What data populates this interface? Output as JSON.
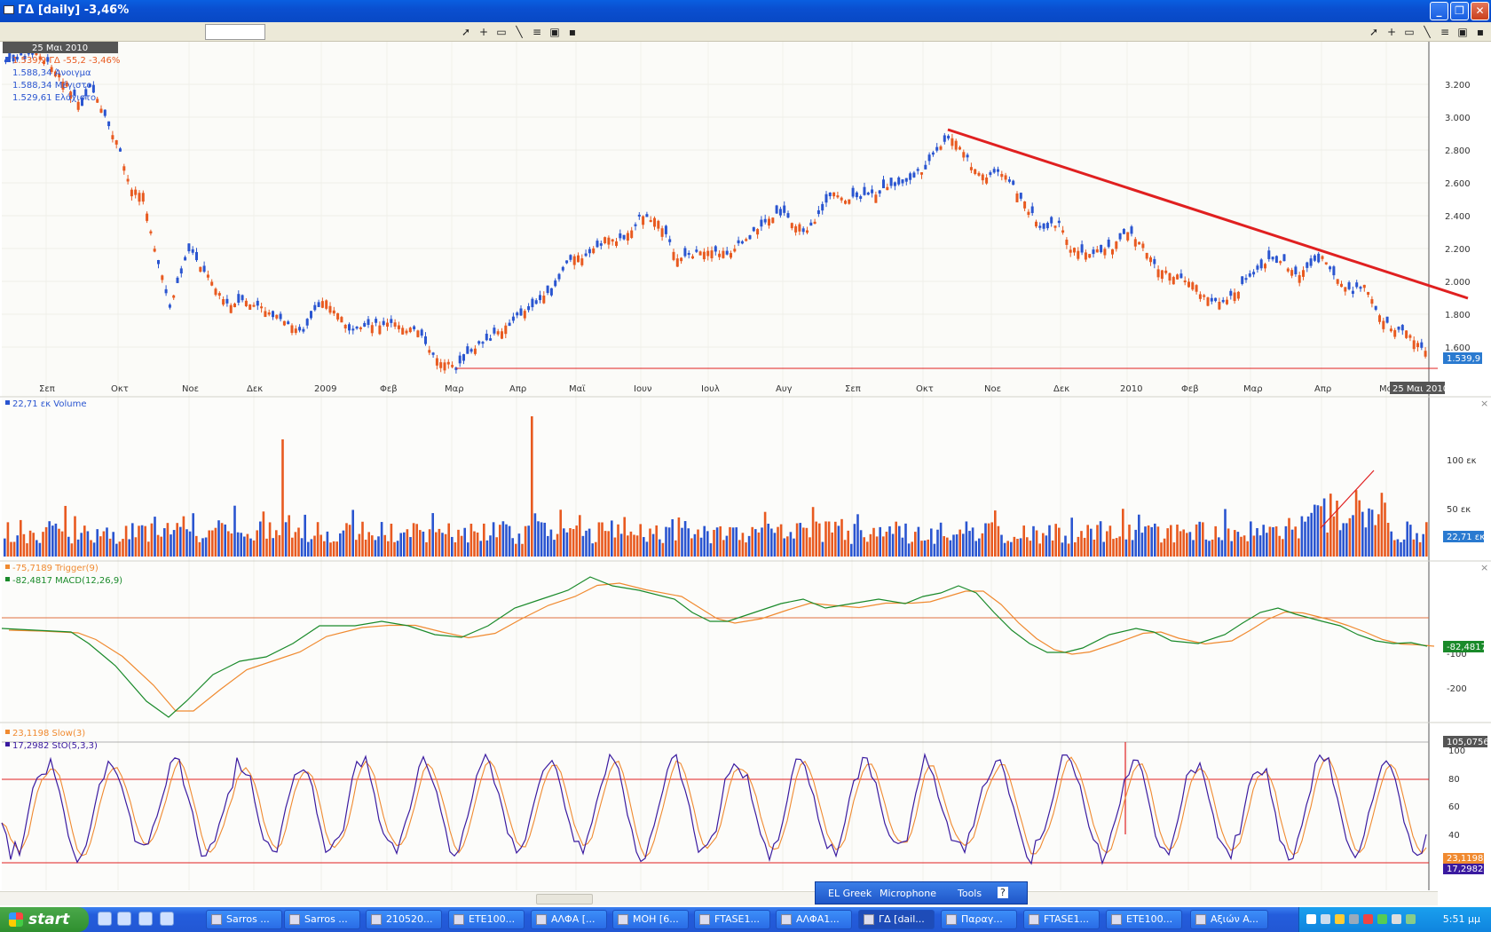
{
  "window": {
    "title": "ΓΔ [daily] -3,46%",
    "symbol_input": ""
  },
  "toolbar": {
    "icons": [
      "cursor-icon",
      "crosshair-icon",
      "rectangle-icon",
      "line-icon",
      "fibonacci-icon",
      "chart-icon",
      "save-icon"
    ]
  },
  "chart": {
    "date_badge": "25 Μαι 2010",
    "legend": {
      "price": "1.539,9 ΓΔ -55,2 -3,46%",
      "open": "1.588,34 Άνοιγμα",
      "high": "1.588,34 Μέγιστο",
      "low": "1.529,61 Ελάχιστο"
    },
    "price_axis": [
      "3.200",
      "3.000",
      "2.800",
      "2.600",
      "2.400",
      "2.200",
      "2.000",
      "1.800",
      "1.600"
    ],
    "price_last": "1.539,9",
    "x_labels": [
      "Σεπ",
      "Οκτ",
      "Νοε",
      "Δεκ",
      "2009",
      "Φεβ",
      "Μαρ",
      "Απρ",
      "Μαϊ",
      "Ιουν",
      "Ιουλ",
      "Αυγ",
      "Σεπ",
      "Οκτ",
      "Νοε",
      "Δεκ",
      "2010",
      "Φεβ",
      "Μαρ",
      "Απρ",
      "Μαϊ"
    ],
    "x_date_badge": "25 Μαι 2010",
    "volume_legend": "22,71 εκ Volume",
    "volume_axis": [
      "100 εκ",
      "50 εκ"
    ],
    "volume_last": "22,71 εκ",
    "macd_legend_trigger": "-75,7189 Trigger(9)",
    "macd_legend_macd": "-82,4817 MACD(12,26,9)",
    "macd_axis": [
      "-100",
      "-200"
    ],
    "macd_last": "-82,4817",
    "stoch_legend_slow": "23,1198 Slow(3)",
    "stoch_legend_sto": "17,2982 StO(5,3,3)",
    "stoch_axis": [
      "100",
      "80",
      "60",
      "40"
    ],
    "stoch_top": "105,0756",
    "stoch_slow_last": "23,1198",
    "stoch_last": "17,2982",
    "colors": {
      "up": "#2a55d0",
      "down": "#e85a20",
      "trend": "#e02020",
      "macd": "#1a8a2a",
      "trigger": "#f08a30",
      "sto": "#3a1aa0",
      "slow": "#f08a30"
    }
  },
  "langbar": {
    "lang": "EL Greek",
    "mic": "Microphone",
    "tools": "Tools"
  },
  "taskbar": {
    "start": "start",
    "tasks": [
      "Sarros ...",
      "Sarros ...",
      "210520...",
      "ETE100...",
      "ΑΛΦΑ [...",
      "ΜΟΗ [6...",
      "FTASE1...",
      "ΑΛΦΑ1...",
      "ΓΔ [dail...",
      "Παραγ...",
      "FTASE1...",
      "ETE100...",
      "Αξιών A..."
    ],
    "clock": "5:51 μμ"
  }
}
